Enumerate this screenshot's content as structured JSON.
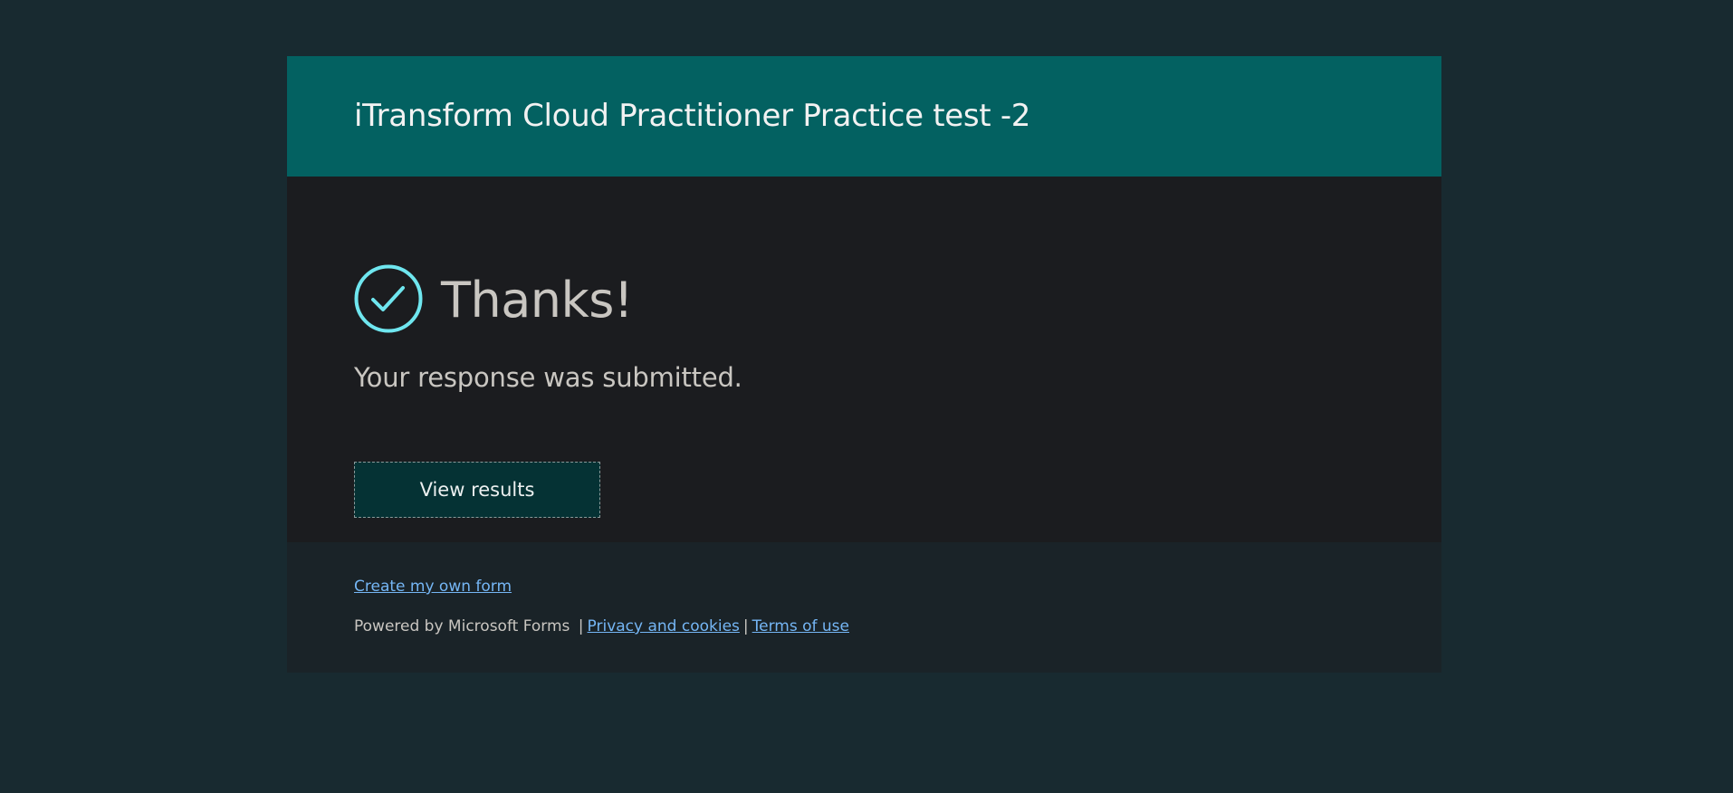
{
  "header": {
    "title": "iTransform Cloud Practitioner Practice test -2"
  },
  "confirmation": {
    "icon": "check-circle-icon",
    "heading": "Thanks!",
    "message": "Your response was submitted.",
    "view_results_label": "View results"
  },
  "footer": {
    "create_form_link": "Create my own form",
    "powered_by": "Powered by Microsoft Forms",
    "separator": "|",
    "privacy_link": "Privacy and cookies",
    "terms_link": "Terms of use"
  },
  "colors": {
    "page_background": "#182a30",
    "header_background": "#036161",
    "body_background": "#1b1c1f",
    "footer_background": "#1a2328",
    "accent_check": "#6fe6ef",
    "button_background": "#053234",
    "link": "#75b6f5"
  }
}
